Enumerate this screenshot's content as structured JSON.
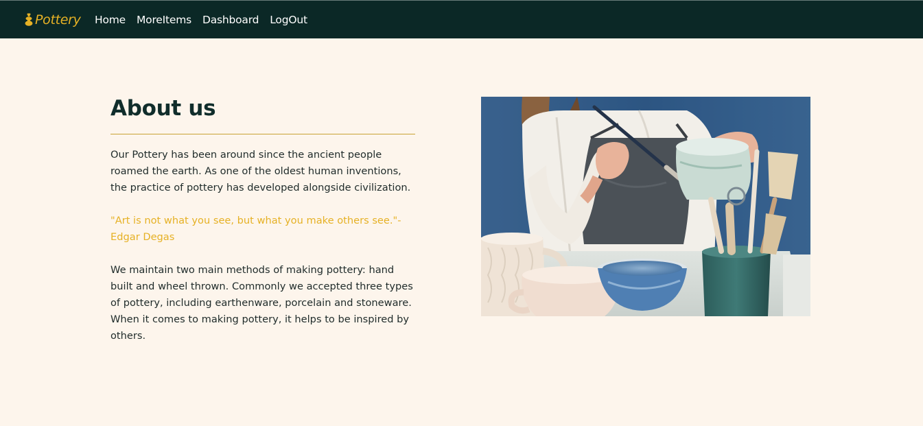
{
  "navbar": {
    "brand": "Pottery",
    "links": [
      "Home",
      "MoreItems",
      "Dashboard",
      "LogOut"
    ]
  },
  "about": {
    "title": "About us",
    "paragraph1": "Our Pottery has been around since the ancient people roamed the earth. As one of the oldest human inventions, the practice of pottery has developed alongside civilization.",
    "quote": "\"Art is not what you see, but what you make others see.\"- Edgar Degas",
    "paragraph2": "We maintain two main methods of making pottery: hand built and wheel thrown. Commonly we accepted three types of pottery, including earthenware, porcelain and stoneware. When it comes to making pottery, it helps to be inspired by others."
  },
  "colors": {
    "navbar_bg": "#0b2826",
    "accent": "#e6b125",
    "page_bg": "#fdf5ec"
  }
}
